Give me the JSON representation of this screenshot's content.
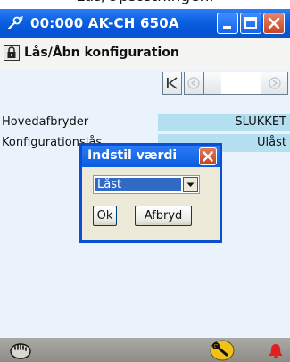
{
  "caption": {
    "partial_text": "Lås/Opsætningen."
  },
  "window": {
    "title": "00:000 AK-CH 650A",
    "app_icon": "wrench-plug-icon",
    "buttons": {
      "minimize": "minimize-icon",
      "maximize": "maximize-icon",
      "close": "close-icon"
    }
  },
  "header": {
    "lock_icon": "lock-icon",
    "title": "Lås/Åbn konfiguration"
  },
  "scroller": {
    "icons": [
      "first-page-icon",
      "prev-page-icon",
      "next-page-icon"
    ]
  },
  "rows": [
    {
      "label": "Hovedafbryder",
      "value": "SLUKKET"
    },
    {
      "label": "Konfigurationslås",
      "value": "Ulåst"
    }
  ],
  "dialog": {
    "title": "Indstil værdi",
    "select_value": "Låst",
    "ok_label": "Ok",
    "cancel_label": "Afbryd"
  },
  "bottombar": {
    "icons": [
      "hand-icon",
      "wrench-icon",
      "alarm-bell-icon"
    ]
  },
  "colors": {
    "titlebar": "#0a5fe0",
    "content_bg": "#eaf3fb",
    "value_bg": "#b4dff0",
    "alarm": "#e02020"
  }
}
